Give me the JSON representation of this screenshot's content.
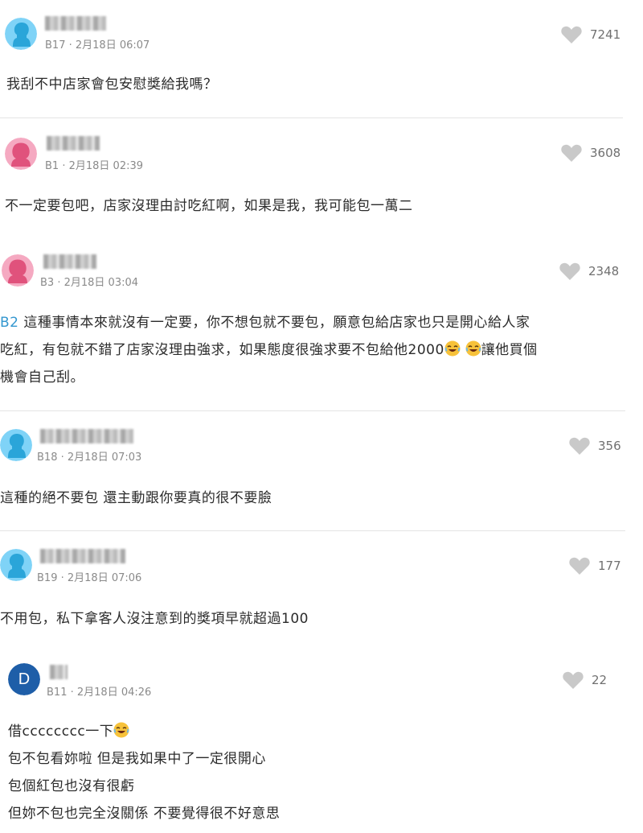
{
  "comments": [
    {
      "floor": "B17",
      "date": "2月18日 06:07",
      "likes": "7241",
      "avatar": "male",
      "text": "我刮不中店家會包安慰獎給我嗎？"
    },
    {
      "floor": "B1",
      "date": "2月18日 02:39",
      "likes": "3608",
      "avatar": "female",
      "text": "不一定要包吧，店家沒理由討吃紅啊，如果是我，我可能包一萬二"
    },
    {
      "floor": "B3",
      "date": "2月18日 03:04",
      "likes": "2348",
      "avatar": "female",
      "reply_to": "B2",
      "lines": [
        "這種事情本來就沒有一定要，你不想包就不要包，願意包給店家也只是開心給人家",
        "吃紅，有包就不錯了店家沒理由強求，如果態度很強求要不包給他2000",
        "讓他買個",
        "機會自己刮。"
      ]
    },
    {
      "floor": "B18",
      "date": "2月18日 07:03",
      "likes": "356",
      "avatar": "male",
      "text": "這種的絕不要包 還主動跟你要真的很不要臉"
    },
    {
      "floor": "B19",
      "date": "2月18日 07:06",
      "likes": "177",
      "avatar": "male",
      "text": "不用包，私下拿客人沒注意到的獎項早就超過100"
    },
    {
      "floor": "B11",
      "date": "2月18日 04:26",
      "likes": "22",
      "avatar": "letter",
      "avatar_letter": "D",
      "lines": [
        "借cccccccc一下",
        "包不包看妳啦 但是我如果中了一定很開心",
        "包個紅包也沒有很虧",
        "但妳不包也完全沒關係 不要覺得很不好意思"
      ]
    }
  ],
  "colors": {
    "male_avatar_bg": "#7fd3f7",
    "male_avatar_fg": "#2aa5d9",
    "female_avatar_bg": "#f5a9c1",
    "female_avatar_fg": "#e0527c",
    "letter_avatar_bg": "#1e5ea8",
    "heart": "#c9c9c9",
    "link": "#3397cf"
  },
  "icons": {
    "like": "heart-icon",
    "emoji": "laughing-emoji-icon"
  }
}
